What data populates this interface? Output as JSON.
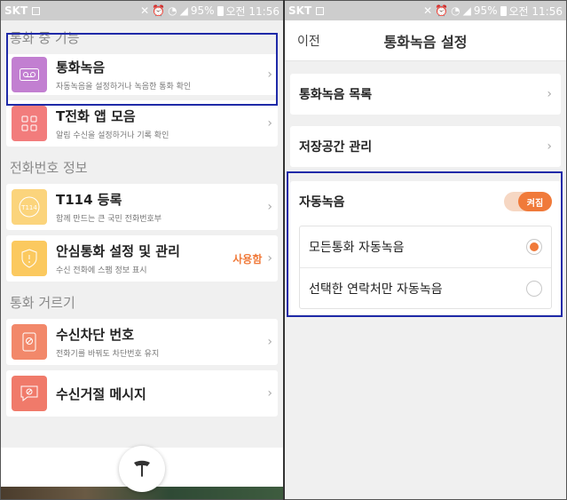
{
  "left": {
    "status": {
      "carrier": "SKT",
      "battery": "95%",
      "time": "오전 11:56"
    },
    "sections": [
      {
        "title": "통화 중 기능",
        "items": [
          {
            "title": "통화녹음",
            "subtitle": "자동녹음을 설정하거나 녹음한 통화 확인",
            "icon": "recorder-icon",
            "color": "#c27fd1"
          },
          {
            "title": "T전화 앱 모음",
            "subtitle": "알림 수신을 설정하거나 기록 확인",
            "icon": "app-grid-icon",
            "color": "#f27c7c"
          }
        ]
      },
      {
        "title": "전화번호 정보",
        "items": [
          {
            "title": "T114 등록",
            "subtitle": "함께 만드는 큰 국민 전화번호부",
            "icon": "t114-icon",
            "color": "#fbd47c"
          },
          {
            "title": "안심통화 설정 및 관리",
            "subtitle": "수신 전화에 스팸 정보 표시",
            "icon": "shield-icon",
            "color": "#fbc95f",
            "badge": "사용함"
          }
        ]
      },
      {
        "title": "통화 거르기",
        "items": [
          {
            "title": "수신차단 번호",
            "subtitle": "전화기를 바꿔도 차단번호 유지",
            "icon": "block-phone-icon",
            "color": "#f2886a"
          },
          {
            "title": "수신거절 메시지",
            "subtitle": "",
            "icon": "message-icon",
            "color": "#f07a6a"
          }
        ]
      }
    ]
  },
  "right": {
    "status": {
      "carrier": "SKT",
      "battery": "95%",
      "time": "오전 11:56"
    },
    "header": {
      "back": "이전",
      "title": "통화녹음 설정"
    },
    "items": [
      {
        "label": "통화녹음 목록"
      },
      {
        "label": "저장공간 관리"
      }
    ],
    "auto_record": {
      "label": "자동녹음",
      "toggle": "켜짐"
    },
    "options": [
      {
        "label": "모든통화 자동녹음",
        "selected": true
      },
      {
        "label": "선택한 연락처만 자동녹음",
        "selected": false
      }
    ]
  },
  "colors": {
    "accent": "#f07a3a",
    "highlight": "#1f2aa8"
  }
}
